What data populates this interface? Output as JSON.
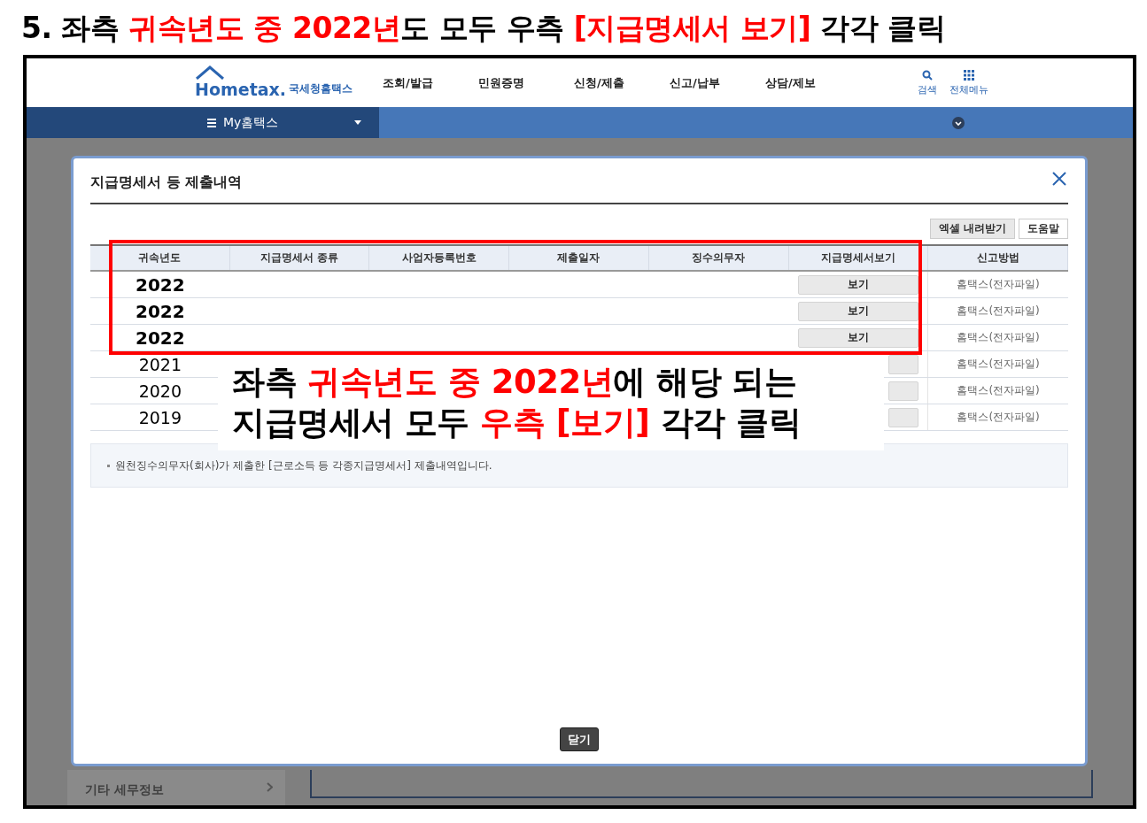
{
  "heading": [
    {
      "text": "5. 좌측 ",
      "emphasis": false
    },
    {
      "text": "귀속년도 중 2022년",
      "emphasis": true
    },
    {
      "text": "도 모두 우측 ",
      "emphasis": false
    },
    {
      "text": "[지급명세서 보기]",
      "emphasis": true
    },
    {
      "text": " 각각 클릭",
      "emphasis": false
    }
  ],
  "site_header": {
    "logo": "Hometax.",
    "logo_sub": "국세청홈택스",
    "menu": [
      "조회/발급",
      "민원증명",
      "신청/제출",
      "신고/납부",
      "상담/제보"
    ],
    "search": "검색",
    "all_menu": "전체메뉴"
  },
  "nav_bar": {
    "menu_label": "My홈택스"
  },
  "sidebar_item": "기타 세무정보",
  "dialog": {
    "title": "지급명세서 등 제출내역",
    "buttons": [
      "엑셀 내려받기",
      "도움말"
    ],
    "columns": [
      "귀속년도",
      "지급명세서 종류",
      "사업자등록번호",
      "제출일자",
      "징수의무자",
      "지급명세서보기",
      "신고방법"
    ],
    "rows": [
      {
        "year": "2022",
        "emphasized": true,
        "view": "보기",
        "method": "홈택스(전자파일)"
      },
      {
        "year": "2022",
        "emphasized": true,
        "view": "보기",
        "method": "홈택스(전자파일)"
      },
      {
        "year": "2022",
        "emphasized": true,
        "view": "보기",
        "method": "홈택스(전자파일)"
      },
      {
        "year": "2021",
        "emphasized": false,
        "method": "홈택스(전자파일)"
      },
      {
        "year": "2020",
        "emphasized": false,
        "method": "홈택스(전자파일)"
      },
      {
        "year": "2019",
        "emphasized": false,
        "method": "홈택스(전자파일)"
      }
    ],
    "note": "원천징수의무자(회사)가 제출한 [근로소득 등 각종지급명세서] 제출내역입니다.",
    "close": "닫기"
  },
  "annotation": {
    "lines": [
      [
        {
          "text": "좌측 ",
          "emphasis": false
        },
        {
          "text": "귀속년도 중 2022년",
          "emphasis": true
        },
        {
          "text": "에 해당 되는",
          "emphasis": false
        }
      ],
      [
        {
          "text": "지급명세서 모두 ",
          "emphasis": false
        },
        {
          "text": "우측 [보기]",
          "emphasis": true
        },
        {
          "text": " 각각 클릭",
          "emphasis": false
        }
      ]
    ]
  }
}
